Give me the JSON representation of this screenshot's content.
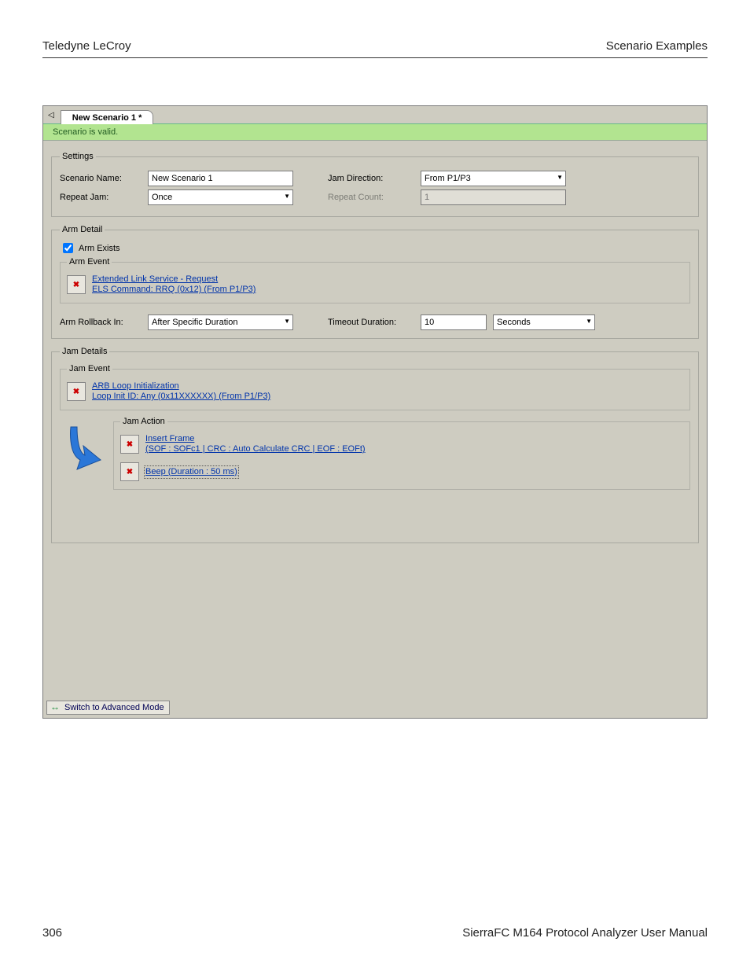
{
  "doc": {
    "header_left": "Teledyne LeCroy",
    "header_right": "Scenario Examples",
    "footer_left": "306",
    "footer_right": "SierraFC M164 Protocol Analyzer User Manual"
  },
  "tab": {
    "title": "New Scenario 1 *"
  },
  "status": "Scenario is valid.",
  "settings": {
    "legend": "Settings",
    "scenario_name_label": "Scenario Name:",
    "scenario_name_value": "New Scenario 1",
    "repeat_jam_label": "Repeat Jam:",
    "repeat_jam_value": "Once",
    "jam_direction_label": "Jam Direction:",
    "jam_direction_value": "From P1/P3",
    "repeat_count_label": "Repeat Count:",
    "repeat_count_value": "1"
  },
  "arm": {
    "legend": "Arm Detail",
    "arm_exists_label": "Arm Exists",
    "arm_exists_checked": true,
    "event_legend": "Arm Event",
    "event_title": "Extended Link Service - Request",
    "event_detail": "ELS Command: RRQ (0x12) (From P1/P3)",
    "rollback_label": "Arm Rollback In:",
    "rollback_value": "After Specific Duration",
    "timeout_label": "Timeout Duration:",
    "timeout_value": "10",
    "timeout_unit": "Seconds"
  },
  "jam": {
    "legend": "Jam Details",
    "event_legend": "Jam Event",
    "event_title": "ARB Loop Initialization",
    "event_detail": "Loop Init ID: Any (0x11XXXXXX) (From P1/P3)",
    "action_legend": "Jam Action",
    "action1_title": "Insert Frame",
    "action1_detail": "(SOF : SOFc1 | CRC : Auto Calculate CRC | EOF : EOFt)",
    "action2_title": "Beep (Duration : 50 ms)"
  },
  "footer_btn": "Switch to Advanced Mode"
}
